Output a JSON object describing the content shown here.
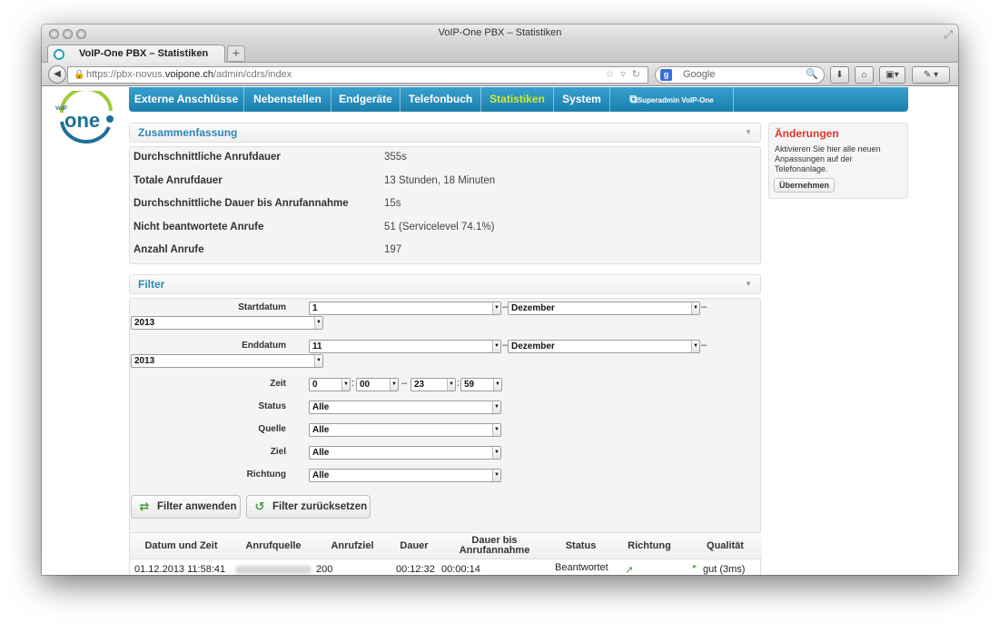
{
  "window": {
    "title": "VoIP-One PBX – Statistiken"
  },
  "browser": {
    "tab_title": "VoIP-One PBX – Statistiken",
    "new_tab": "+",
    "url_prefix": "https://pbx-novus.",
    "url_host": "voipone.ch",
    "url_path": "/admin/cdrs/index",
    "search_placeholder": "Google"
  },
  "nav": {
    "items": [
      "Externe Anschlüsse",
      "Nebenstellen",
      "Endgeräte",
      "Telefonbuch",
      "Statistiken",
      "System"
    ],
    "active": "Statistiken",
    "superadmin": "Superadmin VoIP-One"
  },
  "summary": {
    "title": "Zusammenfassung",
    "rows": [
      {
        "label": "Durchschnittliche Anrufdauer",
        "value": "355s"
      },
      {
        "label": "Totale Anrufdauer",
        "value": "13 Stunden, 18 Minuten"
      },
      {
        "label": "Durchschnittliche Dauer bis Anrufannahme",
        "value": "15s"
      },
      {
        "label": "Nicht beantwortete Anrufe",
        "value": "51 (Servicelevel 74.1%)"
      },
      {
        "label": "Anzahl Anrufe",
        "value": "197"
      }
    ]
  },
  "filter": {
    "title": "Filter",
    "start_label": "Startdatum",
    "start_day": "1",
    "start_month": "Dezember",
    "start_year": "2013",
    "end_label": "Enddatum",
    "end_day": "11",
    "end_month": "Dezember",
    "end_year": "2013",
    "time_label": "Zeit",
    "time_from_h": "0",
    "time_from_m": "00",
    "time_to_h": "23",
    "time_to_m": "59",
    "status_label": "Status",
    "status_value": "Alle",
    "source_label": "Quelle",
    "source_value": "Alle",
    "target_label": "Ziel",
    "target_value": "Alle",
    "direction_label": "Richtung",
    "direction_value": "Alle",
    "apply_button": "Filter anwenden",
    "reset_button": "Filter zurücksetzen"
  },
  "table": {
    "headers": [
      "Datum und Zeit",
      "Anrufquelle",
      "Anrufziel",
      "Dauer",
      "Dauer bis Anrufannahme",
      "Status",
      "Richtung",
      "Qualität"
    ],
    "rows": [
      {
        "datetime": "01.12.2013 11:58:41",
        "target": "200",
        "duration": "00:12:32",
        "answer": "00:00:14",
        "status": "Beantwortet",
        "quality": "gut (3ms)"
      }
    ]
  },
  "changes": {
    "title": "Änderungen",
    "text": "Aktivieren Sie hier alle neuen Anpassungen auf der Telefonanlage.",
    "button": "Übernehmen"
  },
  "colors": {
    "nav": "#2a8fc0",
    "active_nav": "#d2ea2c",
    "section_title": "#2f86b5",
    "changes_title": "#e0352b"
  }
}
